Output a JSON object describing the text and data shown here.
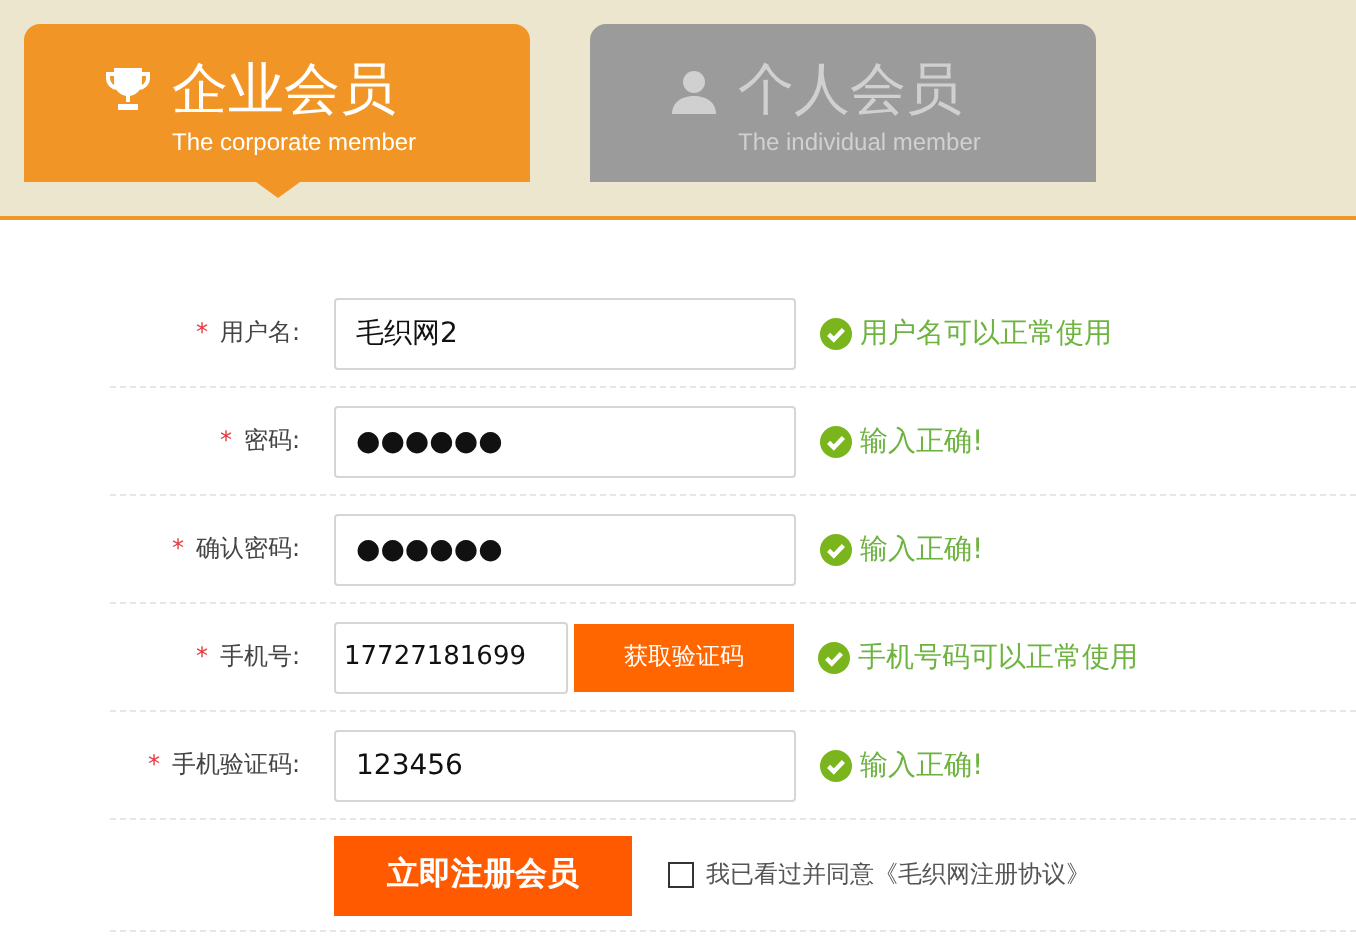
{
  "tabs": [
    {
      "title": "企业会员",
      "subtitle": "The corporate member",
      "selected": true
    },
    {
      "title": "个人会员",
      "subtitle": "The individual member",
      "selected": false
    }
  ],
  "form": {
    "rows": [
      {
        "label": "用户名:",
        "mark": "*",
        "value": "毛织网2",
        "status": {
          "ok": true,
          "text": "用户名可以正常使用"
        }
      },
      {
        "label": "密码:",
        "mark": "*",
        "value": "●●●●●●",
        "status": {
          "ok": true,
          "text": "输入正确!"
        }
      },
      {
        "label": "确认密码:",
        "mark": "*",
        "value": "●●●●●●",
        "status": {
          "ok": true,
          "text": "输入正确!"
        }
      },
      {
        "label": "手机号:",
        "mark": "*",
        "value": "17727181699",
        "button": "获取验证码",
        "status": {
          "ok": true,
          "text": "手机号码可以正常使用"
        }
      },
      {
        "label": "手机验证码:",
        "mark": "*",
        "value": "123456",
        "status": {
          "ok": true,
          "text": "输入正确!"
        }
      }
    ],
    "submit": "立即注册会员",
    "agreement": {
      "checked": false,
      "text": "我已看过并同意《毛织网注册协议》"
    }
  }
}
